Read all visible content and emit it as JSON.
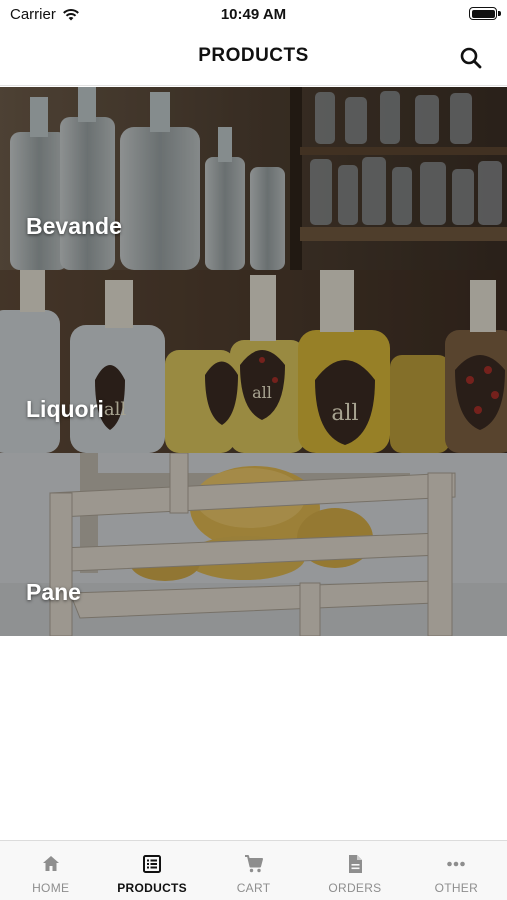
{
  "status_bar": {
    "carrier": "Carrier",
    "time": "10:49 AM",
    "battery_level": 1.0
  },
  "header": {
    "title": "PRODUCTS",
    "search_icon": "search-icon"
  },
  "categories": [
    {
      "label": "Bevande"
    },
    {
      "label": "Liquori"
    },
    {
      "label": "Pane"
    }
  ],
  "tabs": [
    {
      "label": "HOME",
      "icon": "home-icon",
      "active": false
    },
    {
      "label": "PRODUCTS",
      "icon": "list-icon",
      "active": true
    },
    {
      "label": "CART",
      "icon": "cart-icon",
      "active": false
    },
    {
      "label": "ORDERS",
      "icon": "document-icon",
      "active": false
    },
    {
      "label": "OTHER",
      "icon": "more-icon",
      "active": false
    }
  ],
  "colors": {
    "active_tab": "#111111",
    "inactive_tab": "#8e8e8e",
    "tabbar_bg": "#f8f8f8"
  }
}
